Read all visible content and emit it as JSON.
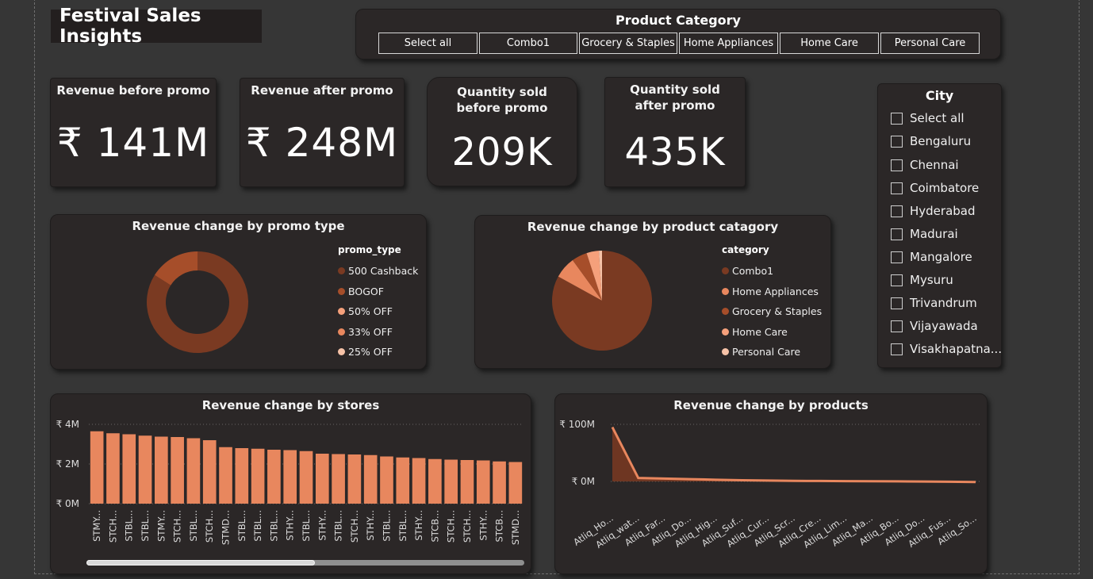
{
  "dashboard": {
    "title": "Festival Sales Insights"
  },
  "product_category": {
    "title": "Product Category",
    "options": [
      "Select all",
      "Combo1",
      "Grocery & Staples",
      "Home Appliances",
      "Home Care",
      "Personal Care"
    ]
  },
  "kpis": [
    {
      "label": "Revenue before promo",
      "value": "₹ 141M"
    },
    {
      "label": "Revenue after promo",
      "value": "₹ 248M"
    },
    {
      "label": "Quantity sold before promo",
      "value": "209K"
    },
    {
      "label": "Quantity sold after promo",
      "value": "435K"
    }
  ],
  "city": {
    "title": "City",
    "options": [
      "Select all",
      "Bengaluru",
      "Chennai",
      "Coimbatore",
      "Hyderabad",
      "Madurai",
      "Mangalore",
      "Mysuru",
      "Trivandrum",
      "Vijayawada",
      "Visakhapatna..."
    ]
  },
  "colors": {
    "bg": "#363636",
    "card": "#2b2727",
    "bar": "#e8875e",
    "dark_series": "#7a3a22"
  },
  "chart_data": [
    {
      "type": "pie",
      "variant": "donut",
      "title": "Revenue change by promo type",
      "legend_title": "promo_type",
      "legend_position": "right",
      "categories": [
        "500 Cashback",
        "BOGOF",
        "50% OFF",
        "33% OFF",
        "25% OFF"
      ],
      "values": [
        84,
        16,
        0,
        0,
        0
      ],
      "colors": [
        "#7a3a22",
        "#a64e2a",
        "#f5a07b",
        "#e8875e",
        "#f7c3a8"
      ]
    },
    {
      "type": "pie",
      "title": "Revenue change by product catagory",
      "legend_title": "category",
      "legend_position": "right",
      "categories": [
        "Combo1",
        "Home Appliances",
        "Grocery & Staples",
        "Home Care",
        "Personal Care"
      ],
      "values": [
        83,
        7,
        5,
        4,
        1
      ],
      "colors": [
        "#7a3a22",
        "#e8875e",
        "#a64e2a",
        "#f5a07b",
        "#f7c3a8"
      ]
    },
    {
      "type": "bar",
      "title": "Revenue change by stores",
      "ylim": [
        0,
        4
      ],
      "y_ticks": [
        "₹ 0M",
        "₹ 2M",
        "₹ 4M"
      ],
      "y_tick_values": [
        0,
        2,
        4
      ],
      "categories": [
        "STMY...",
        "STCH...",
        "STBL...",
        "STBL...",
        "STMY...",
        "STCH...",
        "STBL...",
        "STCH...",
        "STMD...",
        "STBL...",
        "STBL...",
        "STBL...",
        "STHY...",
        "STBL...",
        "STHY...",
        "STBL...",
        "STCH...",
        "STHY...",
        "STBL...",
        "STBL...",
        "STHY...",
        "STCB...",
        "STCH...",
        "STCH...",
        "STHY...",
        "STCB...",
        "STMD..."
      ],
      "values": [
        3.65,
        3.55,
        3.5,
        3.43,
        3.38,
        3.36,
        3.3,
        3.2,
        2.85,
        2.8,
        2.77,
        2.72,
        2.7,
        2.65,
        2.52,
        2.5,
        2.48,
        2.45,
        2.38,
        2.33,
        2.3,
        2.25,
        2.22,
        2.2,
        2.18,
        2.13,
        2.1
      ]
    },
    {
      "type": "area",
      "title": "Revenue change by products",
      "ylim": [
        0,
        100
      ],
      "y_ticks": [
        "₹ 100M",
        "₹ 0M"
      ],
      "y_tick_values": [
        100,
        0
      ],
      "categories": [
        "Atliq_Ho...",
        "Atliq_wat...",
        "Atliq_Far...",
        "Atliq_Do...",
        "Atliq_Hig...",
        "Atliq_Suf...",
        "Atliq_Cur...",
        "Atliq_Scr...",
        "Atliq_Cre...",
        "Atliq_Lim...",
        "Atliq_Ma...",
        "Atliq_Bo...",
        "Atliq_Do...",
        "Atliq_Fus...",
        "Atliq_So..."
      ],
      "values": [
        95,
        6,
        5,
        4,
        3,
        2,
        1.5,
        1,
        0.8,
        0.5,
        0.3,
        0.1,
        -0.2,
        -0.5,
        -1
      ]
    }
  ]
}
